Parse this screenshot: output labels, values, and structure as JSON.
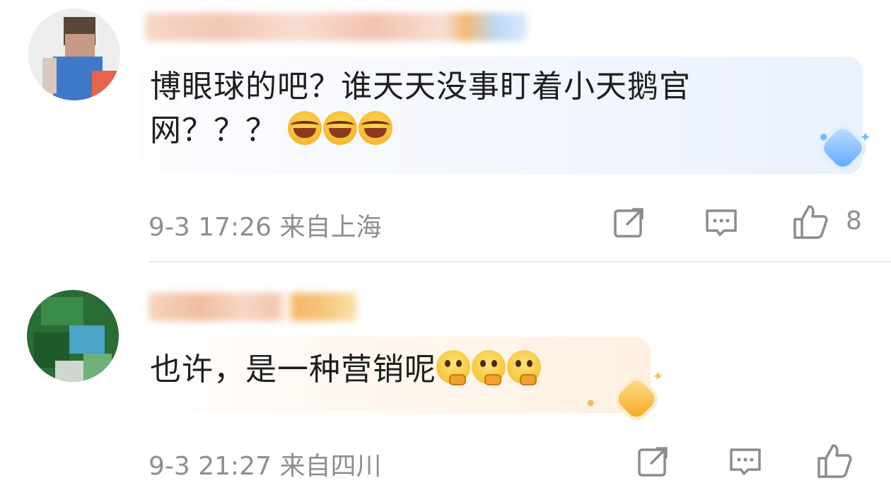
{
  "comments": [
    {
      "text": "博眼球的吧？谁天天没事盯着小天鹅官网？？？",
      "emojis": [
        "laugh",
        "laugh",
        "laugh"
      ],
      "timestamp": "9-3 17:26",
      "location": "来自上海",
      "like_count": "8",
      "badge": "blue-diamond-icon"
    },
    {
      "text": "也许，是一种营销呢",
      "emojis": [
        "think",
        "think",
        "think"
      ],
      "timestamp": "9-3 21:27",
      "location": "来自四川",
      "like_count": "",
      "badge": "gold-diamond-icon"
    }
  ]
}
